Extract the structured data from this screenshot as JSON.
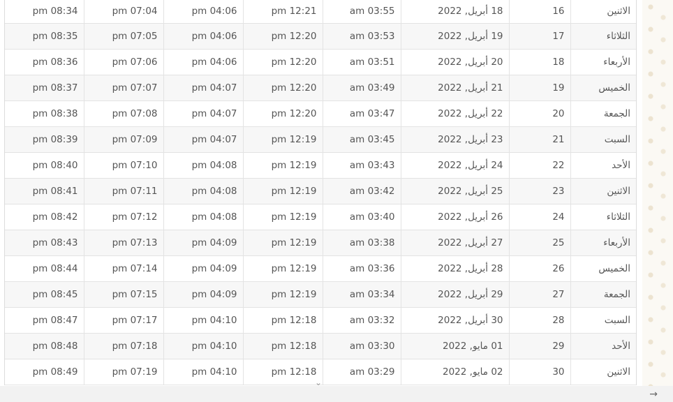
{
  "table": {
    "rows": [
      {
        "c1": "pm 08:34",
        "c2": "pm 07:04",
        "c3": "pm 04:06",
        "c4": "pm 12:21",
        "c5": "am 03:55",
        "date": "18 أبريل, 2022",
        "num": "16",
        "day": "الاثنين"
      },
      {
        "c1": "pm 08:35",
        "c2": "pm 07:05",
        "c3": "pm 04:06",
        "c4": "pm 12:20",
        "c5": "am 03:53",
        "date": "19 أبريل, 2022",
        "num": "17",
        "day": "الثلاثاء"
      },
      {
        "c1": "pm 08:36",
        "c2": "pm 07:06",
        "c3": "pm 04:06",
        "c4": "pm 12:20",
        "c5": "am 03:51",
        "date": "20 أبريل, 2022",
        "num": "18",
        "day": "الأربعاء"
      },
      {
        "c1": "pm 08:37",
        "c2": "pm 07:07",
        "c3": "pm 04:07",
        "c4": "pm 12:20",
        "c5": "am 03:49",
        "date": "21 أبريل, 2022",
        "num": "19",
        "day": "الخميس"
      },
      {
        "c1": "pm 08:38",
        "c2": "pm 07:08",
        "c3": "pm 04:07",
        "c4": "pm 12:20",
        "c5": "am 03:47",
        "date": "22 أبريل, 2022",
        "num": "20",
        "day": "الجمعة"
      },
      {
        "c1": "pm 08:39",
        "c2": "pm 07:09",
        "c3": "pm 04:07",
        "c4": "pm 12:19",
        "c5": "am 03:45",
        "date": "23 أبريل, 2022",
        "num": "21",
        "day": "السبت"
      },
      {
        "c1": "pm 08:40",
        "c2": "pm 07:10",
        "c3": "pm 04:08",
        "c4": "pm 12:19",
        "c5": "am 03:43",
        "date": "24 أبريل, 2022",
        "num": "22",
        "day": "الأحد"
      },
      {
        "c1": "pm 08:41",
        "c2": "pm 07:11",
        "c3": "pm 04:08",
        "c4": "pm 12:19",
        "c5": "am 03:42",
        "date": "25 أبريل, 2022",
        "num": "23",
        "day": "الاثنين"
      },
      {
        "c1": "pm 08:42",
        "c2": "pm 07:12",
        "c3": "pm 04:08",
        "c4": "pm 12:19",
        "c5": "am 03:40",
        "date": "26 أبريل, 2022",
        "num": "24",
        "day": "الثلاثاء"
      },
      {
        "c1": "pm 08:43",
        "c2": "pm 07:13",
        "c3": "pm 04:09",
        "c4": "pm 12:19",
        "c5": "am 03:38",
        "date": "27 أبريل, 2022",
        "num": "25",
        "day": "الأربعاء"
      },
      {
        "c1": "pm 08:44",
        "c2": "pm 07:14",
        "c3": "pm 04:09",
        "c4": "pm 12:19",
        "c5": "am 03:36",
        "date": "28 أبريل, 2022",
        "num": "26",
        "day": "الخميس"
      },
      {
        "c1": "pm 08:45",
        "c2": "pm 07:15",
        "c3": "pm 04:09",
        "c4": "pm 12:19",
        "c5": "am 03:34",
        "date": "29 أبريل, 2022",
        "num": "27",
        "day": "الجمعة"
      },
      {
        "c1": "pm 08:47",
        "c2": "pm 07:17",
        "c3": "pm 04:10",
        "c4": "pm 12:18",
        "c5": "am 03:32",
        "date": "30 أبريل, 2022",
        "num": "28",
        "day": "السبت"
      },
      {
        "c1": "pm 08:48",
        "c2": "pm 07:18",
        "c3": "pm 04:10",
        "c4": "pm 12:18",
        "c5": "am 03:30",
        "date": "01 مايو, 2022",
        "num": "29",
        "day": "الأحد"
      },
      {
        "c1": "pm 08:49",
        "c2": "pm 07:19",
        "c3": "pm 04:10",
        "c4": "pm 12:18",
        "c5": "am 03:29",
        "date": "02 مايو, 2022",
        "num": "30",
        "day": "الاثنين"
      }
    ]
  },
  "icons": {
    "scroll_down": "chevron-down-icon",
    "next": "arrow-right-icon"
  },
  "glyphs": {
    "scroll_down": "⌄",
    "next": "→"
  },
  "colors": {
    "row_alt": "#f7f7f7",
    "border": "#e3e3e3",
    "text": "#555555"
  }
}
